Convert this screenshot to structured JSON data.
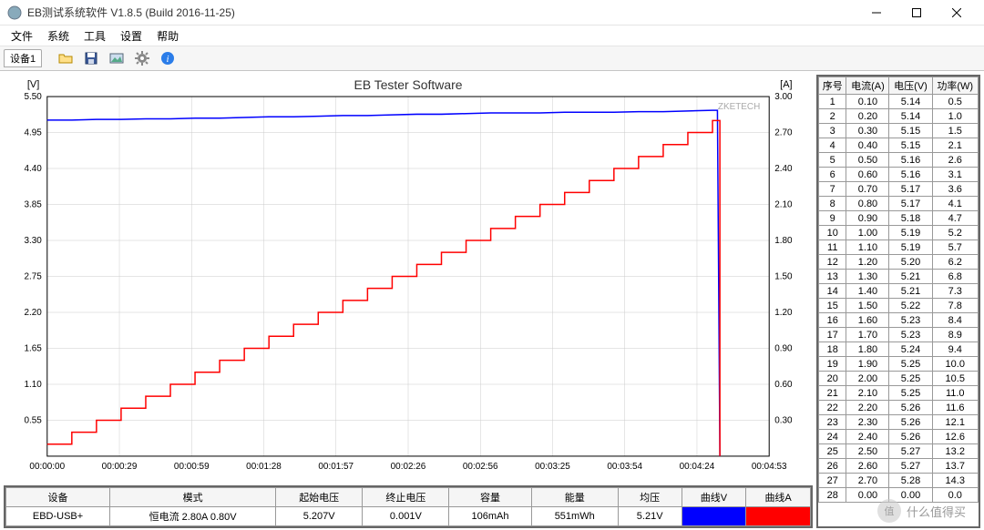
{
  "window": {
    "title": "EB测试系统软件 V1.8.5 (Build 2016-11-25)"
  },
  "menu": [
    "文件",
    "系统",
    "工具",
    "设置",
    "帮助"
  ],
  "device_tab": "设备1",
  "chart_data": {
    "type": "line",
    "title": "EB Tester Software",
    "watermark": "ZKETECH",
    "y_left_label": "[V]",
    "y_right_label": "[A]",
    "y_left_ticks": [
      0.55,
      1.1,
      1.65,
      2.2,
      2.75,
      3.3,
      3.85,
      4.4,
      4.95,
      5.5
    ],
    "y_right_ticks": [
      0.3,
      0.6,
      0.9,
      1.2,
      1.5,
      1.8,
      2.1,
      2.4,
      2.7,
      3.0
    ],
    "y_left_range": [
      0,
      5.5
    ],
    "y_right_range": [
      0,
      3.0
    ],
    "x_ticks": [
      "00:00:00",
      "00:00:29",
      "00:00:59",
      "00:01:28",
      "00:01:57",
      "00:02:26",
      "00:02:56",
      "00:03:25",
      "00:03:54",
      "00:04:24",
      "00:04:53"
    ],
    "x_range_sec": [
      0,
      293
    ],
    "series": [
      {
        "name": "电压 V",
        "color": "#0000ff",
        "axis": "left",
        "points": [
          [
            0,
            5.14
          ],
          [
            10,
            5.14
          ],
          [
            20,
            5.15
          ],
          [
            30,
            5.15
          ],
          [
            40,
            5.16
          ],
          [
            50,
            5.16
          ],
          [
            60,
            5.17
          ],
          [
            70,
            5.17
          ],
          [
            80,
            5.18
          ],
          [
            90,
            5.19
          ],
          [
            100,
            5.19
          ],
          [
            110,
            5.2
          ],
          [
            120,
            5.21
          ],
          [
            130,
            5.21
          ],
          [
            140,
            5.22
          ],
          [
            150,
            5.23
          ],
          [
            160,
            5.23
          ],
          [
            170,
            5.24
          ],
          [
            180,
            5.25
          ],
          [
            190,
            5.25
          ],
          [
            200,
            5.25
          ],
          [
            210,
            5.26
          ],
          [
            220,
            5.26
          ],
          [
            230,
            5.26
          ],
          [
            240,
            5.27
          ],
          [
            250,
            5.27
          ],
          [
            260,
            5.28
          ],
          [
            270,
            5.29
          ],
          [
            272,
            5.29
          ],
          [
            273,
            0.001
          ]
        ]
      },
      {
        "name": "电流 A",
        "color": "#ff0000",
        "axis": "right",
        "step": true,
        "points": [
          [
            0,
            0.1
          ],
          [
            10,
            0.2
          ],
          [
            20,
            0.3
          ],
          [
            30,
            0.4
          ],
          [
            40,
            0.5
          ],
          [
            50,
            0.6
          ],
          [
            60,
            0.7
          ],
          [
            70,
            0.8
          ],
          [
            80,
            0.9
          ],
          [
            90,
            1.0
          ],
          [
            100,
            1.1
          ],
          [
            110,
            1.2
          ],
          [
            120,
            1.3
          ],
          [
            130,
            1.4
          ],
          [
            140,
            1.5
          ],
          [
            150,
            1.6
          ],
          [
            160,
            1.7
          ],
          [
            170,
            1.8
          ],
          [
            180,
            1.9
          ],
          [
            190,
            2.0
          ],
          [
            200,
            2.1
          ],
          [
            210,
            2.2
          ],
          [
            220,
            2.3
          ],
          [
            230,
            2.4
          ],
          [
            240,
            2.5
          ],
          [
            250,
            2.6
          ],
          [
            260,
            2.7
          ],
          [
            270,
            2.8
          ],
          [
            272,
            2.8
          ],
          [
            273,
            0.0
          ]
        ]
      }
    ]
  },
  "bottom_table": {
    "headers": [
      "设备",
      "模式",
      "起始电压",
      "终止电压",
      "容量",
      "能量",
      "均压",
      "曲线V",
      "曲线A"
    ],
    "row": {
      "device": "EBD-USB+",
      "mode": "恒电流 2.80A 0.80V",
      "start_v": "5.207V",
      "end_v": "0.001V",
      "capacity": "106mAh",
      "energy": "551mWh",
      "avg_v": "5.21V",
      "color_v": "#0000ff",
      "color_a": "#ff0000"
    }
  },
  "side_table": {
    "headers": [
      "序号",
      "电流(A)",
      "电压(V)",
      "功率(W)"
    ],
    "rows": [
      [
        1,
        "0.10",
        "5.14",
        "0.5"
      ],
      [
        2,
        "0.20",
        "5.14",
        "1.0"
      ],
      [
        3,
        "0.30",
        "5.15",
        "1.5"
      ],
      [
        4,
        "0.40",
        "5.15",
        "2.1"
      ],
      [
        5,
        "0.50",
        "5.16",
        "2.6"
      ],
      [
        6,
        "0.60",
        "5.16",
        "3.1"
      ],
      [
        7,
        "0.70",
        "5.17",
        "3.6"
      ],
      [
        8,
        "0.80",
        "5.17",
        "4.1"
      ],
      [
        9,
        "0.90",
        "5.18",
        "4.7"
      ],
      [
        10,
        "1.00",
        "5.19",
        "5.2"
      ],
      [
        11,
        "1.10",
        "5.19",
        "5.7"
      ],
      [
        12,
        "1.20",
        "5.20",
        "6.2"
      ],
      [
        13,
        "1.30",
        "5.21",
        "6.8"
      ],
      [
        14,
        "1.40",
        "5.21",
        "7.3"
      ],
      [
        15,
        "1.50",
        "5.22",
        "7.8"
      ],
      [
        16,
        "1.60",
        "5.23",
        "8.4"
      ],
      [
        17,
        "1.70",
        "5.23",
        "8.9"
      ],
      [
        18,
        "1.80",
        "5.24",
        "9.4"
      ],
      [
        19,
        "1.90",
        "5.25",
        "10.0"
      ],
      [
        20,
        "2.00",
        "5.25",
        "10.5"
      ],
      [
        21,
        "2.10",
        "5.25",
        "11.0"
      ],
      [
        22,
        "2.20",
        "5.26",
        "11.6"
      ],
      [
        23,
        "2.30",
        "5.26",
        "12.1"
      ],
      [
        24,
        "2.40",
        "5.26",
        "12.6"
      ],
      [
        25,
        "2.50",
        "5.27",
        "13.2"
      ],
      [
        26,
        "2.60",
        "5.27",
        "13.7"
      ],
      [
        27,
        "2.70",
        "5.28",
        "14.3"
      ],
      [
        28,
        "0.00",
        "0.00",
        "0.0"
      ]
    ]
  },
  "page_watermark": "什么值得买"
}
